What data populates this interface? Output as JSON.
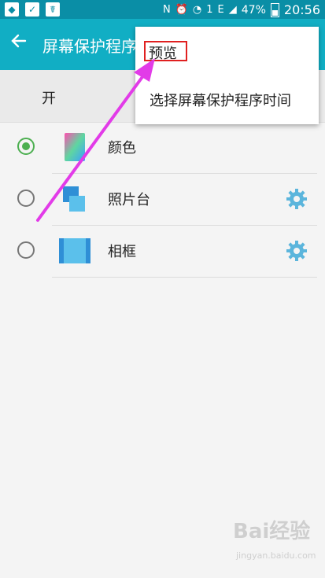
{
  "status_bar": {
    "time": "20:56",
    "battery": "47%",
    "signal_label": "E",
    "sim_badge": "1",
    "nfc_label": "N",
    "icons": [
      "app-icon",
      "check-icon",
      "run-icon",
      "alarm-icon",
      "wifi-icon",
      "signal-icon",
      "battery-icon"
    ]
  },
  "app_bar": {
    "title": "屏幕保护程序",
    "back_icon": "back-arrow-icon"
  },
  "switch_row": {
    "label": "开"
  },
  "options": [
    {
      "label": "颜色",
      "selected": true,
      "has_settings": false
    },
    {
      "label": "照片台",
      "selected": false,
      "has_settings": true
    },
    {
      "label": "相框",
      "selected": false,
      "has_settings": true
    }
  ],
  "menu": {
    "items": [
      "预览",
      "选择屏幕保护程序时间"
    ]
  },
  "watermark": {
    "brand": "Bai经验",
    "url": "jingyan.baidu.com"
  },
  "colors": {
    "status_bar": "#0a8ea6",
    "app_bar": "#11aec4",
    "radio_selected": "#4caf50",
    "gear": "#5bb5dc",
    "annotation_arrow": "#e23be8",
    "annotation_box": "#e02020"
  }
}
